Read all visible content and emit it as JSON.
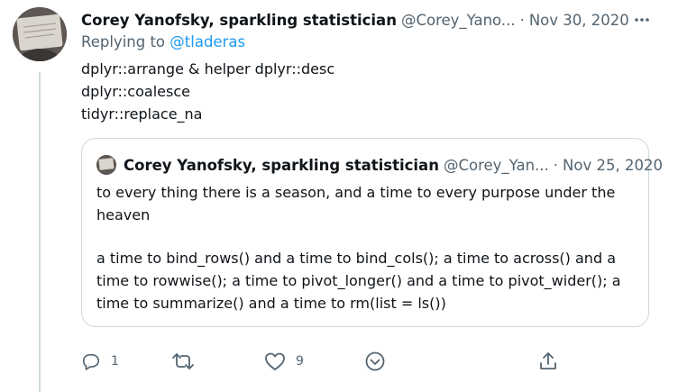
{
  "tweet": {
    "author_name": "Corey Yanofsky, sparkling statistician",
    "handle": "@Corey_Yano...",
    "separator": "·",
    "date": "Nov 30, 2020",
    "replying_prefix": "Replying to",
    "replying_to": "@tladeras",
    "lines": [
      "dplyr::arrange & helper dplyr::desc",
      "dplyr::coalesce",
      "tidyr::replace_na"
    ]
  },
  "quote": {
    "author_name": "Corey Yanofsky, sparkling statistician",
    "handle": "@Corey_Yan...",
    "separator": "·",
    "date": "Nov 25, 2020",
    "paragraphs": [
      "to every thing there is a season, and a time to every purpose under the heaven",
      "a time to bind_rows() and a time to bind_cols(); a time to across() and a time to rowwise(); a time to pivot_longer() and a time to pivot_wider(); a time to summarize() and a time to rm(list = ls())"
    ]
  },
  "actions": {
    "reply_count": "1",
    "retweet_count": "",
    "like_count": "9"
  },
  "icons": {
    "more": "more-horizontal-icon",
    "reply": "reply-icon",
    "retweet": "retweet-icon",
    "like": "heart-icon",
    "bookmark": "bookmark-icon",
    "share": "share-icon"
  },
  "colors": {
    "text": "#0f1419",
    "secondary": "#536471",
    "link": "#1d9bf0",
    "border": "#cfd9de"
  }
}
